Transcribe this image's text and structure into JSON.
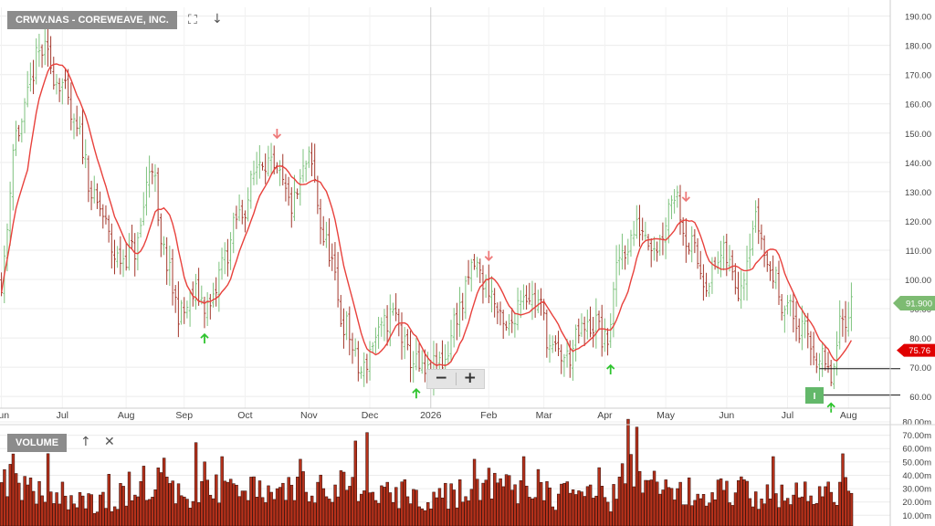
{
  "header": {
    "symbol_label": "CRWV.NAS - COREWEAVE, INC.",
    "fullscreen_icon": "expand-icon",
    "download_icon": "arrow-down-icon"
  },
  "zoom": {
    "minus_label": "−",
    "plus_label": "+"
  },
  "volume_panel": {
    "label": "VOLUME",
    "up_icon": "arrow-up-icon",
    "close_icon": "close-icon"
  },
  "colors": {
    "up_bar": "#7dc27d",
    "down_bar": "#a4382c",
    "moving_average": "#e8413c",
    "volume_bar": "#b5311b",
    "buy_arrow": "#2fc42f",
    "sell_arrow": "#ee7a7a",
    "last_price_tag": "#7dbb72",
    "average_tag": "#e00000",
    "indicator_box": "#63b86a"
  },
  "chart_data": {
    "type": "ohlc",
    "price_axis": {
      "ticks": [
        "60.00",
        "70.00",
        "80.00",
        "90.00",
        "100.00",
        "110.00",
        "120.00",
        "130.00",
        "140.00",
        "150.00",
        "160.00",
        "170.00",
        "180.00",
        "190.00"
      ],
      "ylim": [
        56,
        193
      ]
    },
    "x_axis": {
      "months": [
        "Jun",
        "Jul",
        "Aug",
        "Sep",
        "Oct",
        "Nov",
        "Dec",
        "2026",
        "Feb",
        "Mar",
        "Apr",
        "May",
        "Jun",
        "Jul",
        "Aug"
      ]
    },
    "last_price_label": "91.900",
    "moving_average_label": "75.76",
    "indicator_label": "I",
    "price_anchors": [
      [
        0,
        100
      ],
      [
        5,
        150
      ],
      [
        14,
        178
      ],
      [
        20,
        168
      ],
      [
        26,
        150
      ],
      [
        33,
        125
      ],
      [
        40,
        107
      ],
      [
        46,
        110
      ],
      [
        52,
        140
      ],
      [
        55,
        110
      ],
      [
        62,
        88
      ],
      [
        67,
        95
      ],
      [
        72,
        90
      ],
      [
        77,
        108
      ],
      [
        82,
        122
      ],
      [
        90,
        142
      ],
      [
        95,
        135
      ],
      [
        100,
        125
      ],
      [
        106,
        140
      ],
      [
        112,
        112
      ],
      [
        118,
        85
      ],
      [
        124,
        68
      ],
      [
        129,
        80
      ],
      [
        135,
        88
      ],
      [
        141,
        73
      ],
      [
        146,
        67
      ],
      [
        152,
        72
      ],
      [
        158,
        90
      ],
      [
        163,
        105
      ],
      [
        167,
        98
      ],
      [
        174,
        82
      ],
      [
        180,
        96
      ],
      [
        185,
        92
      ],
      [
        190,
        75
      ],
      [
        195,
        73
      ],
      [
        200,
        82
      ],
      [
        205,
        85
      ],
      [
        208,
        78
      ],
      [
        214,
        110
      ],
      [
        220,
        118
      ],
      [
        226,
        112
      ],
      [
        232,
        130
      ],
      [
        237,
        112
      ],
      [
        243,
        100
      ],
      [
        249,
        108
      ],
      [
        254,
        98
      ],
      [
        260,
        120
      ],
      [
        265,
        103
      ],
      [
        270,
        92
      ],
      [
        276,
        82
      ],
      [
        282,
        73
      ],
      [
        286,
        66
      ],
      [
        290,
        86
      ],
      [
        293,
        92
      ]
    ],
    "volume_axis": {
      "ticks": [
        "10.00m",
        "20.00m",
        "30.00m",
        "40.00m",
        "50.00m",
        "60.00m",
        "70.00m",
        "80.00m"
      ],
      "ylim": [
        2,
        80
      ]
    },
    "volume_anchors": [
      [
        0,
        38
      ],
      [
        10,
        28
      ],
      [
        20,
        26
      ],
      [
        35,
        18
      ],
      [
        50,
        36
      ],
      [
        60,
        26
      ],
      [
        75,
        30
      ],
      [
        90,
        30
      ],
      [
        100,
        28
      ],
      [
        110,
        34
      ],
      [
        120,
        30
      ],
      [
        130,
        24
      ],
      [
        140,
        26
      ],
      [
        150,
        24
      ],
      [
        160,
        28
      ],
      [
        170,
        32
      ],
      [
        185,
        26
      ],
      [
        200,
        24
      ],
      [
        210,
        22
      ],
      [
        216,
        42
      ],
      [
        225,
        30
      ],
      [
        240,
        26
      ],
      [
        255,
        28
      ],
      [
        265,
        24
      ],
      [
        275,
        24
      ],
      [
        285,
        26
      ],
      [
        293,
        32
      ]
    ],
    "volume_spikes": [
      [
        4,
        56
      ],
      [
        70,
        50
      ],
      [
        76,
        54
      ],
      [
        103,
        52
      ],
      [
        126,
        72
      ],
      [
        163,
        52
      ],
      [
        180,
        54
      ],
      [
        216,
        82
      ],
      [
        266,
        54
      ]
    ],
    "buy_arrows_at": [
      70,
      143,
      210,
      286
    ],
    "sell_arrows_at": [
      95,
      168,
      236
    ],
    "support_lines": [
      69.5,
      60.5
    ]
  }
}
